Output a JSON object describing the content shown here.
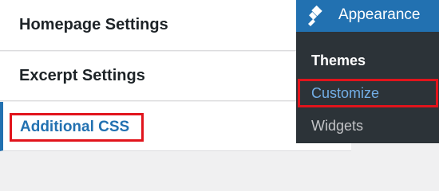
{
  "customizer": {
    "sections": [
      {
        "label": "Homepage Settings"
      },
      {
        "label": "Excerpt Settings"
      },
      {
        "label": "Additional CSS"
      }
    ]
  },
  "admin_menu": {
    "appearance_label": "Appearance",
    "appearance_icon": "paintbrush-icon",
    "submenu": [
      {
        "label": "Themes"
      },
      {
        "label": "Customize"
      },
      {
        "label": "Widgets"
      }
    ]
  },
  "colors": {
    "highlight": "#e1141c",
    "accent": "#2271b1",
    "admin_bg": "#1d2327"
  }
}
